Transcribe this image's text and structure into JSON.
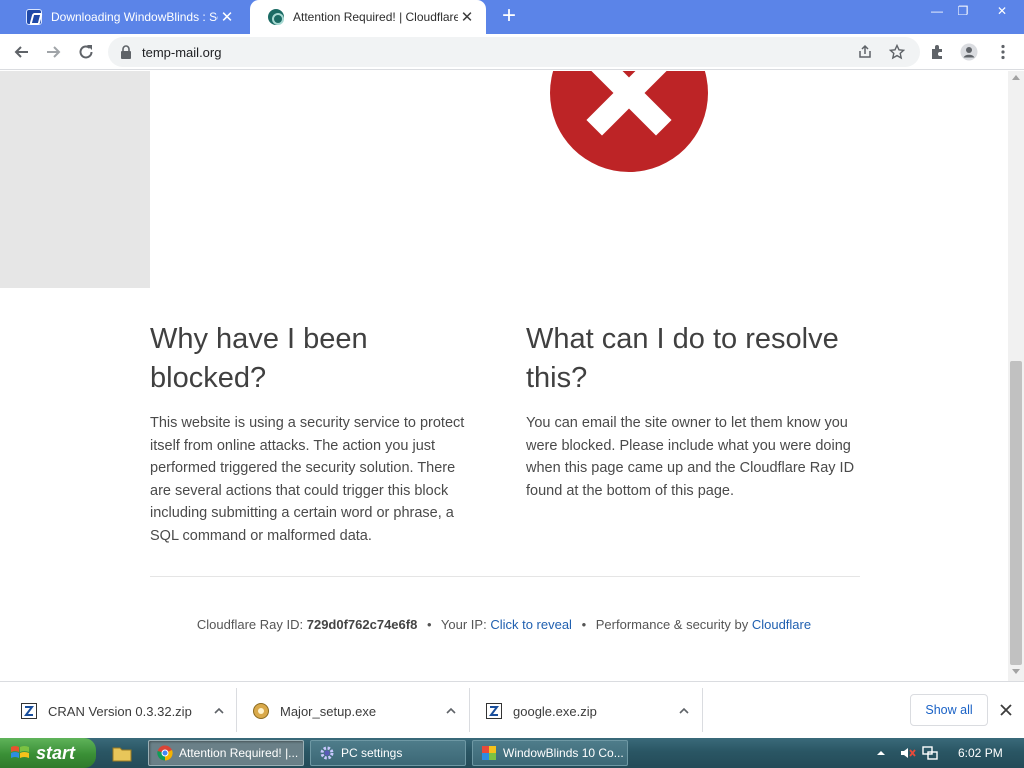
{
  "browser": {
    "tabs": [
      {
        "title": "Downloading WindowBlinds : Sc",
        "active": false
      },
      {
        "title": "Attention Required! | Cloudflare",
        "active": true
      }
    ],
    "new_tab": "+",
    "close_glyph": "✕",
    "window_controls": {
      "minimize": "—",
      "restore": "❐",
      "close": "✕"
    },
    "url": "temp-mail.org",
    "icons": [
      "back-icon",
      "forward-icon",
      "reload-icon",
      "lock-icon",
      "share-icon",
      "star-icon",
      "extensions-icon",
      "profile-icon",
      "menu-icon"
    ]
  },
  "page": {
    "left": {
      "heading": "Why have I been blocked?",
      "body": "This website is using a security service to protect itself from online attacks. The action you just performed triggered the security solution. There are several actions that could trigger this block including submitting a certain word or phrase, a SQL command or malformed data."
    },
    "right": {
      "heading": "What can I do to resolve this?",
      "body": "You can email the site owner to let them know you were blocked. Please include what you were doing when this page came up and the Cloudflare Ray ID found at the bottom of this page."
    },
    "footer": {
      "ray_label": "Cloudflare Ray ID:",
      "ray_id": "729d0f762c74e6f8",
      "bullet": "•",
      "ip_label": "Your IP:",
      "ip_link": "Click to reveal",
      "perf_label": "Performance & security by",
      "perf_link": "Cloudflare"
    },
    "accent_color": "#bd2426"
  },
  "downloads": {
    "items": [
      {
        "name": "CRAN Version 0.3.32.zip"
      },
      {
        "name": "Major_setup.exe"
      },
      {
        "name": "google.exe.zip"
      }
    ],
    "show_all": "Show all"
  },
  "taskbar": {
    "start": "start",
    "tasks": [
      {
        "label": "Attention Required! |..."
      },
      {
        "label": "PC settings"
      },
      {
        "label": "WindowBlinds 10 Co..."
      }
    ],
    "clock": "6:02 PM"
  }
}
